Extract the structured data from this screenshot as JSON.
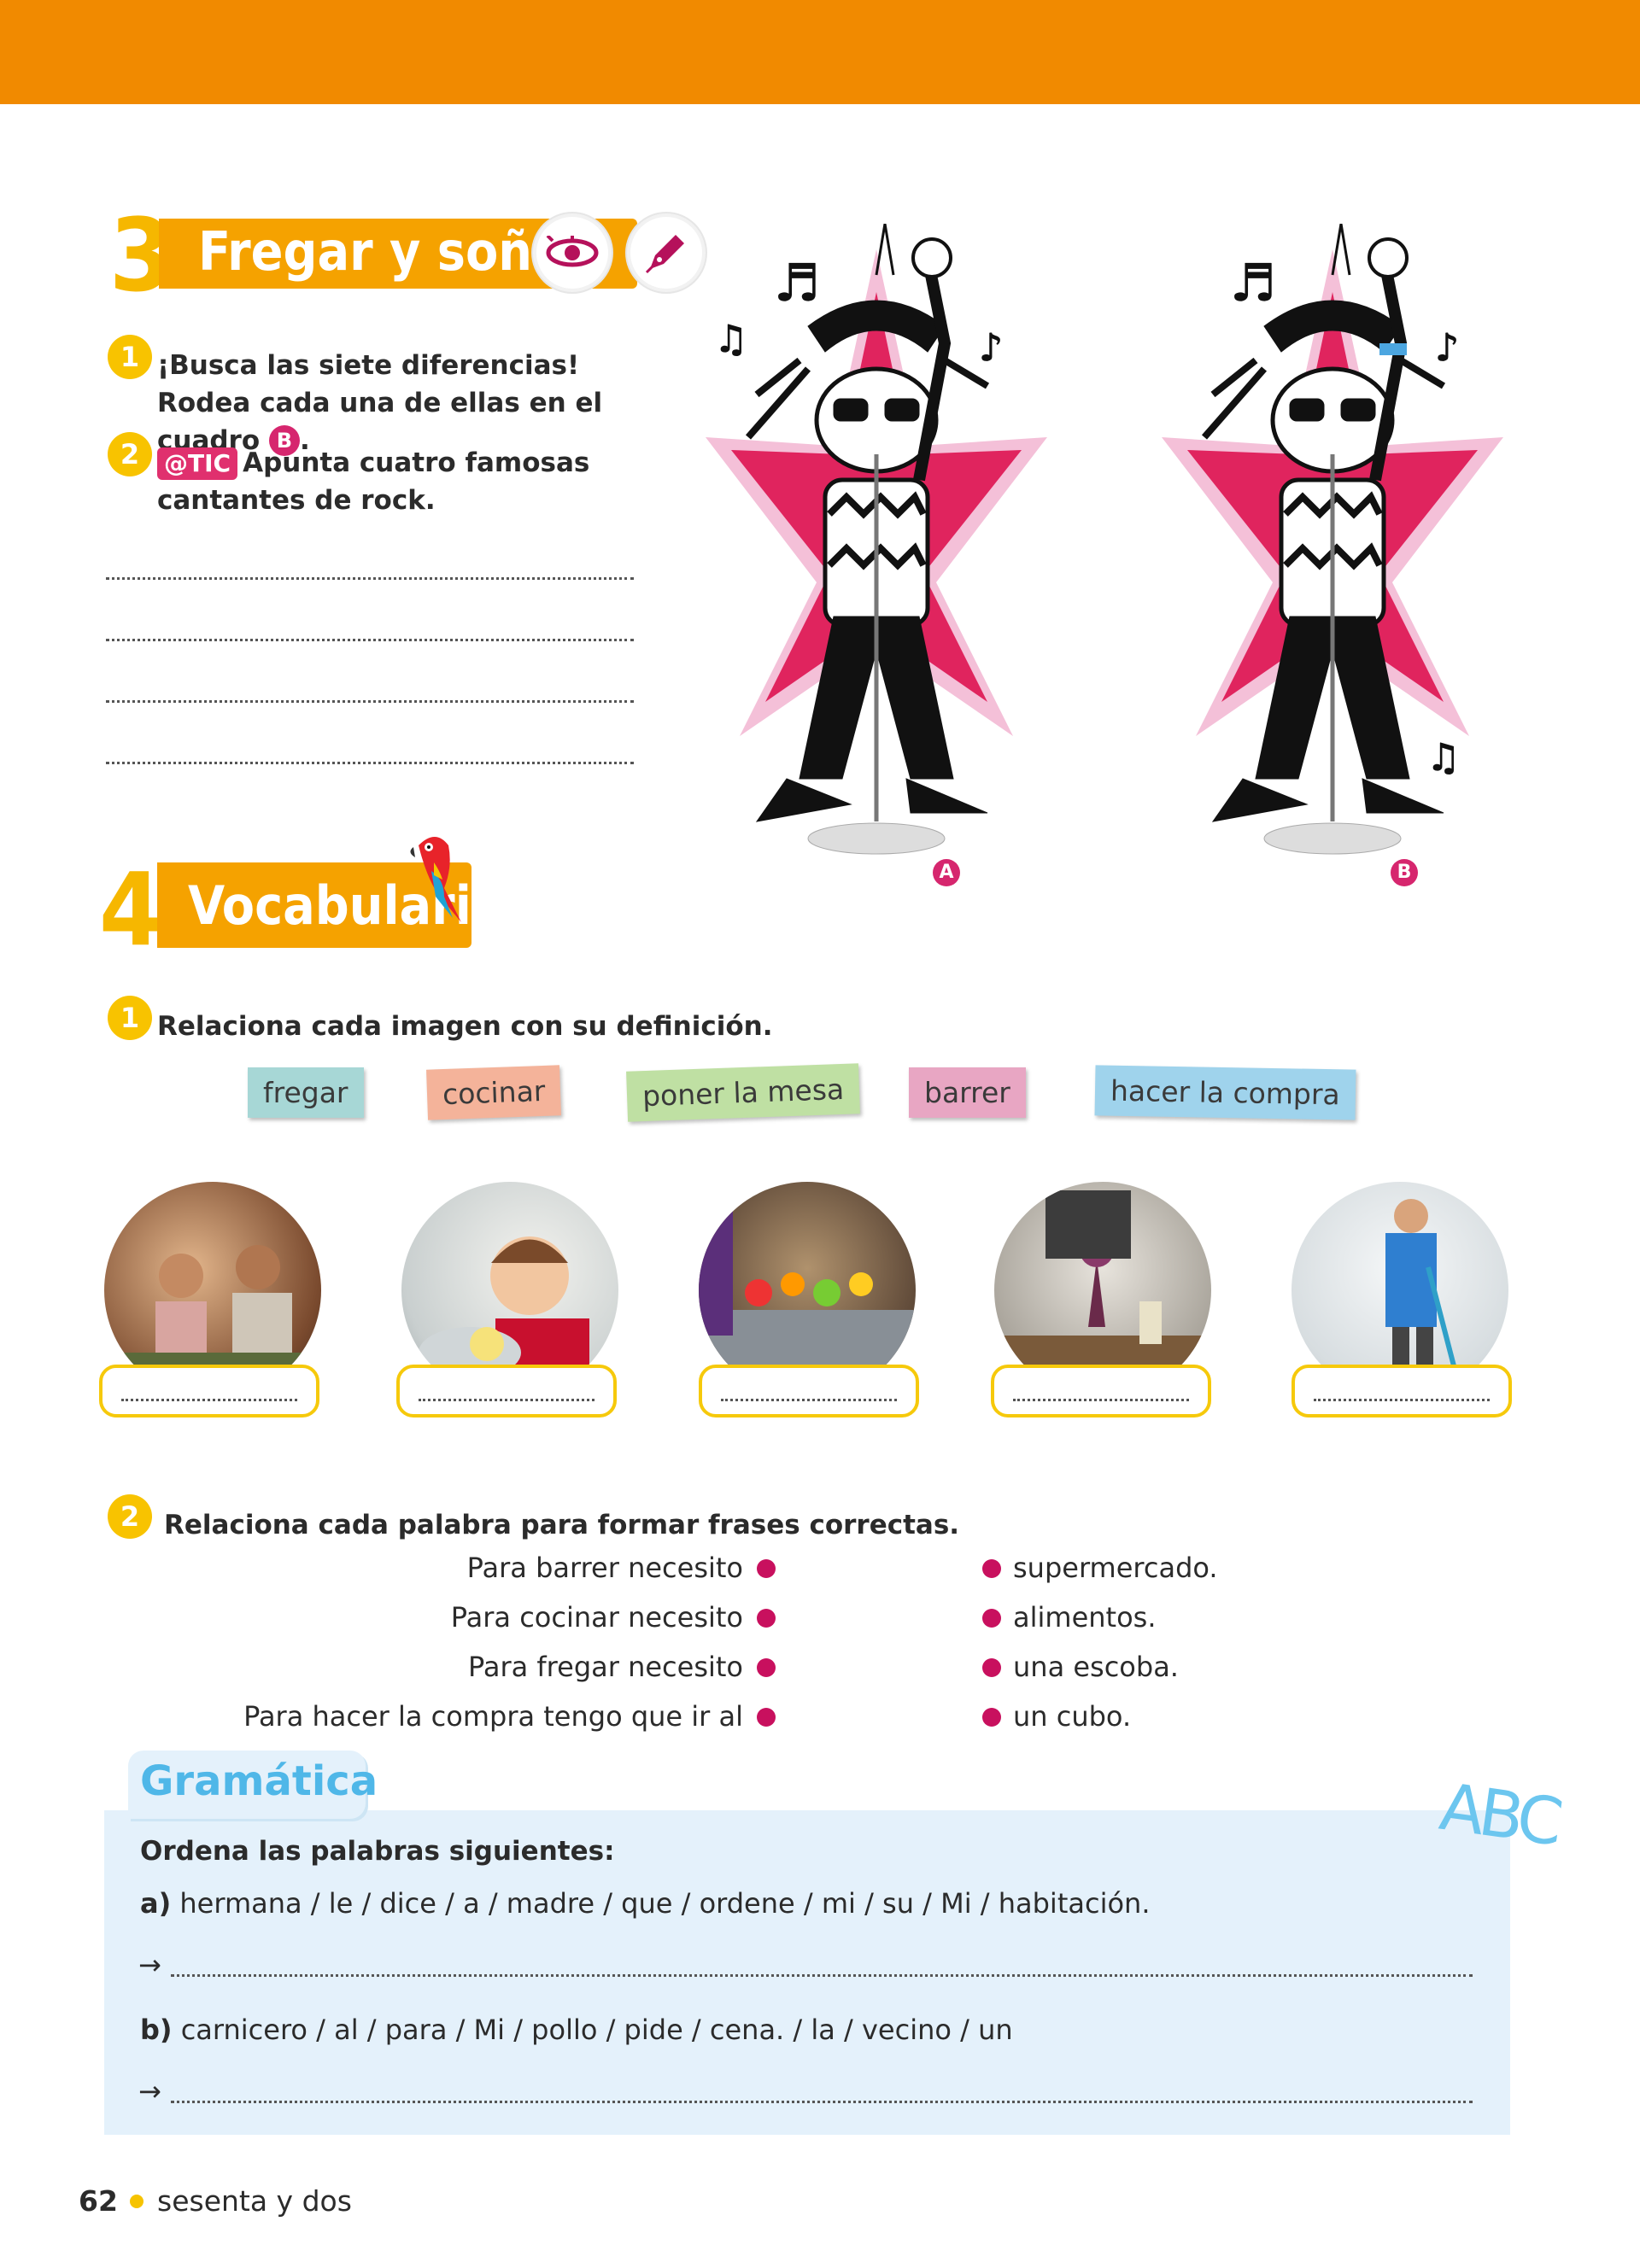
{
  "header": {
    "color": "#f18a00"
  },
  "section3": {
    "number": "3",
    "title": "Fregar y soñar",
    "icons": [
      "eye-icon",
      "pen-icon"
    ],
    "q1_num": "1",
    "q1_text": "¡Busca las siete diferencias! Rodea cada una de ellas en el cuadro",
    "q1_badge": "B",
    "q2_num": "2",
    "q2_tic": "@TIC",
    "q2_text": "Apunta cuatro famosas cantantes de rock.",
    "label_a": "A",
    "label_b": "B"
  },
  "section4": {
    "number": "4",
    "title": "Vocabulario",
    "q1_num": "1",
    "q1_text": "Relaciona cada imagen con su definición.",
    "tags": [
      {
        "label": "fregar",
        "color": "#a7d7d6"
      },
      {
        "label": "cocinar",
        "color": "#f4b39a"
      },
      {
        "label": "poner la mesa",
        "color": "#bfe0a3"
      },
      {
        "label": "barrer",
        "color": "#e8a6c3"
      },
      {
        "label": "hacer la compra",
        "color": "#9fd3ec"
      }
    ],
    "photos": [
      "family-cooking-photo",
      "boy-washing-dishes-photo",
      "supermarket-checkout-photo",
      "table-setting-photo",
      "man-sweeping-photo"
    ],
    "q2_num": "2",
    "q2_text": "Relaciona cada palabra para formar frases correctas.",
    "left": [
      "Para barrer necesito",
      "Para cocinar necesito",
      "Para fregar necesito",
      "Para hacer la compra tengo que ir al"
    ],
    "right": [
      "supermercado.",
      "alimentos.",
      "una escoba.",
      "un cubo."
    ]
  },
  "grammar": {
    "title": "Gramática",
    "instruction": "Ordena las palabras siguientes:",
    "a_label": "a)",
    "a_text": "hermana / le / dice / a / madre / que / ordene / mi / su / Mi / habitación.",
    "b_label": "b)",
    "b_text": "carnicero / al / para / Mi / pollo / pide / cena. / la / vecino / un",
    "arrow": "→",
    "abc": "ABC"
  },
  "footer": {
    "page": "62",
    "text": "sesenta y dos"
  }
}
